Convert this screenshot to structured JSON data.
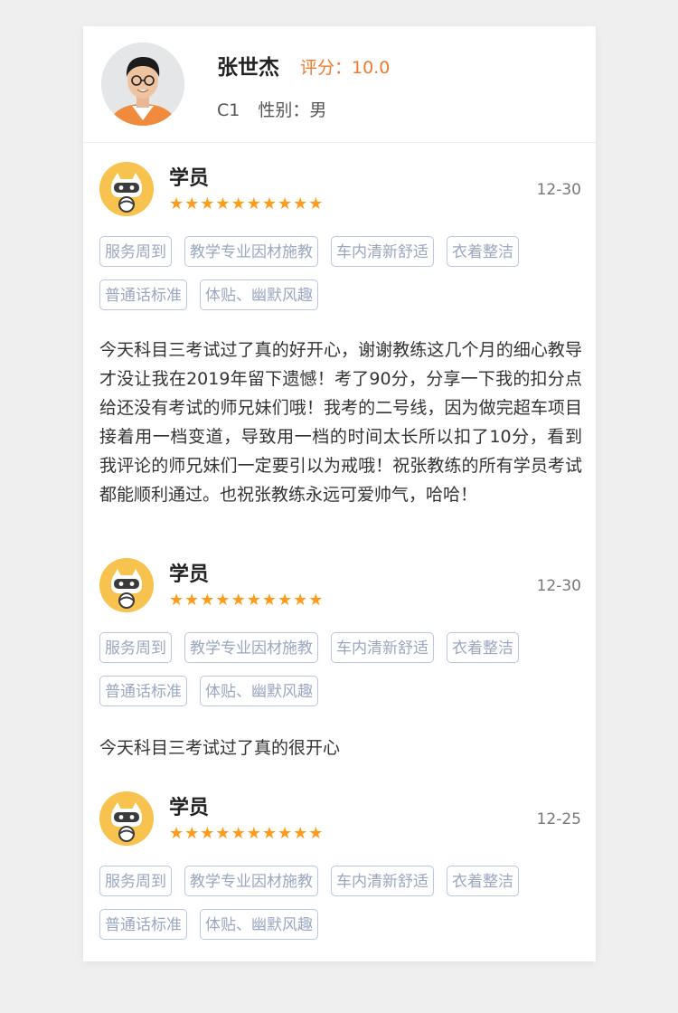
{
  "coach": {
    "name": "张世杰",
    "rating_label": "评分：10.0",
    "license": "C1",
    "gender_label": "性别：男"
  },
  "star_glyph": "★",
  "colors": {
    "accent_orange": "#f07a2a",
    "star": "#ff9a1a",
    "tag_border": "#b9c6de",
    "tag_text": "#9aa7c0",
    "student_avatar_bg": "#f7c34e"
  },
  "reviews": [
    {
      "name": "学员",
      "date": "12-30",
      "stars": 10,
      "tags": [
        "服务周到",
        "教学专业因材施教",
        "车内清新舒适",
        "衣着整洁",
        "普通话标准",
        "体贴、幽默风趣"
      ],
      "text": "今天科目三考试过了真的好开心，谢谢教练这几个月的细心教导才没让我在2019年留下遗憾！考了90分，分享一下我的扣分点给还没有考试的师兄妹们哦！我考的二号线，因为做完超车项目接着用一档变道，导致用一档的时间太长所以扣了10分，看到我评论的师兄妹们一定要引以为戒哦！祝张教练的所有学员考试都能顺利通过。也祝张教练永远可爱帅气，哈哈！"
    },
    {
      "name": "学员",
      "date": "12-30",
      "stars": 10,
      "tags": [
        "服务周到",
        "教学专业因材施教",
        "车内清新舒适",
        "衣着整洁",
        "普通话标准",
        "体贴、幽默风趣"
      ],
      "text": "今天科目三考试过了真的很开心"
    },
    {
      "name": "学员",
      "date": "12-25",
      "stars": 10,
      "tags": [
        "服务周到",
        "教学专业因材施教",
        "车内清新舒适",
        "衣着整洁",
        "普通话标准",
        "体贴、幽默风趣"
      ],
      "text": ""
    }
  ]
}
